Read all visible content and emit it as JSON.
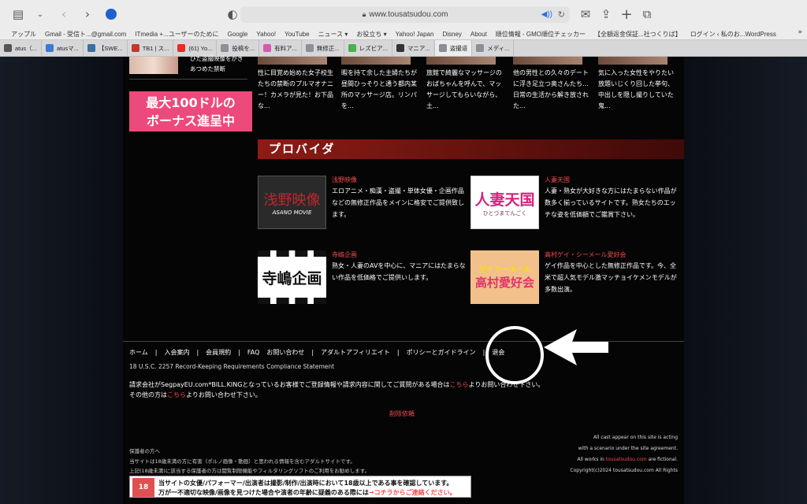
{
  "browser": {
    "url": "www.tousatsudou.com"
  },
  "bookmarks": [
    "アップル",
    "Gmail - 受信ト...@gmail.com",
    "ITmedia +...ユーザーのために",
    "Google",
    "Yahoo!",
    "YouTube",
    "ニュース ▾",
    "お役立ち ▾",
    "Yahoo! Japan",
    "Disney",
    "About",
    "順位情報 - GMO順位チェッカー",
    "【全額返金保証...社つくりば】",
    "ログイン ‹ 私のお...WordPress"
  ],
  "tabs": [
    {
      "label": "atus（...",
      "color": "#555"
    },
    {
      "label": "atusマ...",
      "color": "#3a7bd5"
    },
    {
      "label": "【SWE...",
      "color": "#3b6fa0"
    },
    {
      "label": "TB1 | ス...",
      "color": "#c0392b"
    },
    {
      "label": "(61) Yo...",
      "color": "#e52d27"
    },
    {
      "label": "投稿を...",
      "color": "#8a8f98"
    },
    {
      "label": "有料ア...",
      "color": "#d65ab0"
    },
    {
      "label": "無修正...",
      "color": "#8a8f98"
    },
    {
      "label": "レズビア...",
      "color": "#4caf50"
    },
    {
      "label": "マニア...",
      "color": "#333"
    },
    {
      "label": "盗撮道",
      "color": "#8a8f98"
    },
    {
      "label": "メディ...",
      "color": "#8a8f98"
    }
  ],
  "sidebar": {
    "top_text": "ひた盗撮映像をかきあつめた禁断",
    "banner_line1": "最大100ドルの",
    "banner_line2": "ボーナス進呈中"
  },
  "top_items": [
    {
      "caption": "性に目覚め始めた女子校生たちの禁断のプルマオナニー！カメラが見た！お下品な..."
    },
    {
      "caption": "暇を持て余した主婦たちが昼間ひっそりと通う都内某所のマッサージ店。リンパを..."
    },
    {
      "caption": "旅館で綺麗なマッサージのおばちゃんを呼んで、マッサージしてもらいながら、土..."
    },
    {
      "caption": "他の男性との久々のデートに浮き足立つ奥さんたち…日常の生活から解き放された..."
    },
    {
      "caption": "気に入った女性をやりたい放題いじくり回した挙句、中出しを隠し撮りしていた鬼..."
    }
  ],
  "section_title": "プロバイダ",
  "providers": [
    {
      "name": "浅野映像",
      "logo_main": "浅野映像",
      "logo_sub": "ASANO MOVIE",
      "desc": "エロアニメ・痴漢・盗撮・単体女優・企画作品などの無修正作品をメインに格安でご提供致します。"
    },
    {
      "name": "人妻天国",
      "logo_main": "人妻天国",
      "logo_sub": "ひとづまてんごく",
      "desc": "人妻・熟女が大好きな方にはたまらない作品が数多く揃っているサイトです。熟女たちのエッチな姿を低価額でご鑑賞下さい。"
    },
    {
      "name": "寺嶋企画",
      "logo_main": "寺嶋企画",
      "logo_sub": "",
      "desc": "熟女・人妻のAVを中心に、マニアにはたまらない作品を低価格でご提供いします。"
    },
    {
      "name": "高村ゲイ・シーメール愛好会",
      "logo_main": "高村愛好会",
      "logo_sub": "ゲイ シーメール",
      "desc": "ゲイ作品を中心とした無修正作品です。今、全米で超人気モデル激マッチョイケメンモデルが多数出演。"
    }
  ],
  "footer": {
    "nav": [
      "ホーム",
      "|",
      "入会案内",
      "|",
      "会員規約",
      "|",
      "FAQ",
      "お問い合わせ",
      "|",
      "アダルトアフィリエイト",
      "|",
      "ポリシーとガイドライン",
      "|",
      "退会"
    ],
    "compliance": "18 U.S.C. 2257 Record-Keeping Requirements Compliance Statement",
    "billing_line": "請求会社がSegpayEU.com*BILL.KINGとなっているお客様でご登録情報や請求内容に関してご質問がある場合は",
    "billing_link": "こちら",
    "billing_tail": "よりお問い合わせ下さい。",
    "other_line": "その他の方は",
    "other_link": "こちら",
    "other_tail": "よりお問い合わせ下さい。",
    "delete_request": "削除依頼",
    "guardian_title": "保護者の方へ",
    "guardian_line1": "当サイトは18歳未満の方に有害（ポルノ画像・動画）と思われる情報を含むアダルトサイトです。",
    "guardian_line2": "上記(18歳未満)に該当する保護者の方は閲覧制限機能やフィルタリングソフトのご利用をお勧めします。",
    "right1": "All cast appear on this site is acting",
    "right2": "with a scenario under the site agreement.",
    "right3_pre": "All works in ",
    "right3_link": "tousatsudou.com",
    "right3_post": " are fictional.",
    "copyright": "Copyright(c)2024 tousatsudou.com All Rights",
    "notice_badge": "18",
    "notice_line1": "当サイトの女優/パフォーマー/出演者は撮影/制作/出演時において18歳以上である事を確認しています。",
    "notice_line2": "万が一不適切な映像/画像を見つけた場合や演者の年齢に疑義のある際には",
    "notice_link": "→コチラからご連絡ください。"
  }
}
